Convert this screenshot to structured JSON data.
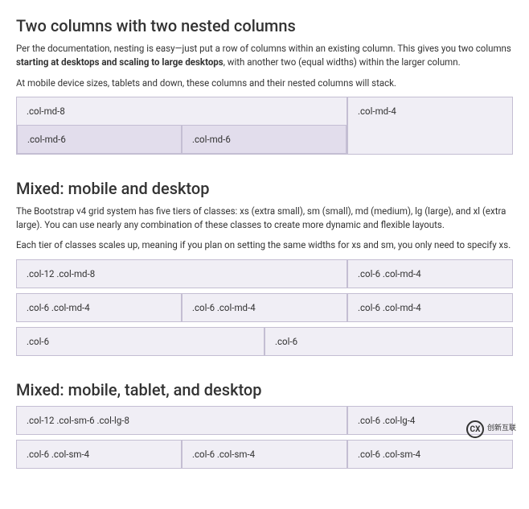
{
  "section1": {
    "title": "Two columns with two nested columns",
    "desc_before_bold": "Per the documentation, nesting is easy—just put a row of columns within an existing column. This gives you two columns ",
    "desc_bold": "starting at desktops and scaling to large desktops",
    "desc_after_bold": ", with another two (equal widths) within the larger column.",
    "desc2": "At mobile device sizes, tablets and down, these columns and their nested columns will stack.",
    "outer_col1": ".col-md-8",
    "outer_col2": ".col-md-4",
    "nested_col1": ".col-md-6",
    "nested_col2": ".col-md-6"
  },
  "section2": {
    "title": "Mixed: mobile and desktop",
    "desc1": "The Bootstrap v4 grid system has five tiers of classes: xs (extra small), sm (small), md (medium), lg (large), and xl (extra large). You can use nearly any combination of these classes to create more dynamic and flexible layouts.",
    "desc2": "Each tier of classes scales up, meaning if you plan on setting the same widths for xs and sm, you only need to specify xs.",
    "row1_col1": ".col-12 .col-md-8",
    "row1_col2": ".col-6 .col-md-4",
    "row2_col1": ".col-6 .col-md-4",
    "row2_col2": ".col-6 .col-md-4",
    "row2_col3": ".col-6 .col-md-4",
    "row3_col1": ".col-6",
    "row3_col2": ".col-6"
  },
  "section3": {
    "title": "Mixed: mobile, tablet, and desktop",
    "row1_col1": ".col-12 .col-sm-6 .col-lg-8",
    "row1_col2": ".col-6 .col-lg-4",
    "row2_col1": ".col-6 .col-sm-4",
    "row2_col2": ".col-6 .col-sm-4",
    "row2_col3": ".col-6 .col-sm-4"
  },
  "logo": {
    "icon_text": "CX",
    "text": "创新互联"
  }
}
